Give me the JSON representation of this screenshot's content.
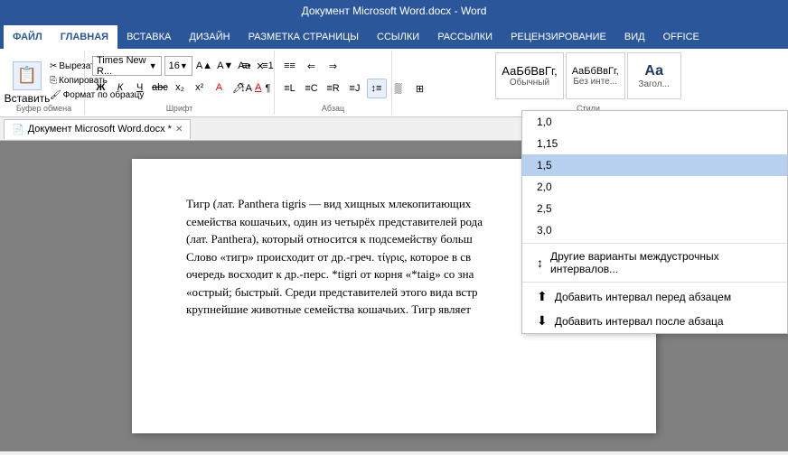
{
  "titlebar": {
    "text": "Документ Microsoft Word.docx - Word"
  },
  "ribbon": {
    "tabs": [
      {
        "label": "ФАЙЛ",
        "active": false
      },
      {
        "label": "ГЛАВНАЯ",
        "active": true
      },
      {
        "label": "ВСТАВКА",
        "active": false
      },
      {
        "label": "ДИЗАЙН",
        "active": false
      },
      {
        "label": "РАЗМЕТКА СТРАНИЦЫ",
        "active": false
      },
      {
        "label": "ССЫЛКИ",
        "active": false
      },
      {
        "label": "РАССЫЛКИ",
        "active": false
      },
      {
        "label": "РЕЦЕНЗИРОВАНИЕ",
        "active": false
      },
      {
        "label": "ВИД",
        "active": false
      },
      {
        "label": "OFFICE",
        "active": false
      }
    ],
    "clipboard": {
      "paste_label": "Вставить",
      "cut_label": "Вырезать",
      "copy_label": "Копировать",
      "format_label": "Формат по образцу",
      "group_label": "Буфер обмена"
    },
    "font": {
      "name": "Times New R...",
      "size": "16",
      "group_label": "Шрифт"
    },
    "paragraph": {
      "group_label": "Абзац"
    },
    "styles": {
      "items": [
        {
          "label": "АаБбВвГг,",
          "name": "Обычный"
        },
        {
          "label": "АаБбВвГг,",
          "name": "Без инте..."
        },
        {
          "label": "Аа",
          "name": "Загол..."
        }
      ],
      "group_label": "Стили"
    }
  },
  "document": {
    "tab_label": "Документ Microsoft Word.docx *",
    "content_lines": [
      "Тигр (лат. Panthera tigris",
      "семейства кошачьих, од",
      "(лат. Panthera), который относится к подсемейству больш",
      "Слово «тигр» происходит от др.-греч. τίγρις, которое в св",
      "очередь восходит к др.-перс. *tigri от корня «*taig» со зна",
      "«острый; быстрый. Среди представителей этого вида встр",
      "крупнейшие животные семейства кошачьих. Тигр являет"
    ]
  },
  "line_spacing_dropdown": {
    "items": [
      {
        "value": "1,0",
        "selected": false
      },
      {
        "value": "1,15",
        "selected": false
      },
      {
        "value": "1,5",
        "selected": true
      },
      {
        "value": "2,0",
        "selected": false
      },
      {
        "value": "2,5",
        "selected": false
      },
      {
        "value": "3,0",
        "selected": false
      }
    ],
    "other_label": "Другие варианты междустрочных интервалов...",
    "add_before_label": "Добавить интервал перед абзацем",
    "add_after_label": "Добавить интервал после абзаца"
  }
}
